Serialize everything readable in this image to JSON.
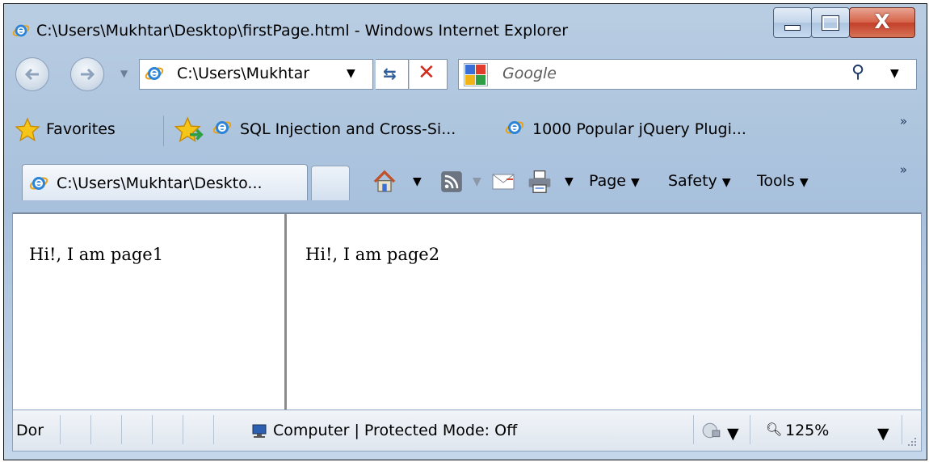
{
  "window": {
    "title": "C:\\Users\\Mukhtar\\Desktop\\firstPage.html - Windows Internet Explorer"
  },
  "address_bar": {
    "url": "C:\\Users\\Mukhtar",
    "dropdown": "▼",
    "search_placeholder": "Google"
  },
  "favorites_bar": {
    "label": "Favorites",
    "links": [
      "SQL Injection and Cross-Si...",
      "1000 Popular jQuery Plugi..."
    ],
    "chevron": "»"
  },
  "tabs": [
    {
      "label": "C:\\Users\\Mukhtar\\Deskto..."
    }
  ],
  "command_bar": {
    "page_label": "Page",
    "safety_label": "Safety",
    "tools_label": "Tools",
    "dropdown": "▼",
    "chevron": "»"
  },
  "frames": [
    {
      "text": "Hi!, I am page1"
    },
    {
      "text": "Hi!, I am page2"
    }
  ],
  "status_bar": {
    "status_text": "Dor",
    "zone_text": "Computer | Protected Mode: Off",
    "zoom_label": "125%",
    "dropdown": "▼"
  },
  "colors": {
    "frame_accent": "#a7c0dc",
    "close_button": "#d6644a",
    "stop_icon": "#d02a1c",
    "ie_blue": "#1f6fc8"
  },
  "icons": [
    "ie-logo-icon",
    "back-arrow-icon",
    "forward-arrow-icon",
    "refresh-icon",
    "stop-icon",
    "google-icon",
    "search-icon",
    "favorites-star-icon",
    "add-favorite-icon",
    "home-icon",
    "feeds-icon",
    "read-mail-icon",
    "print-icon",
    "computer-icon",
    "globe-lock-icon",
    "zoom-icon",
    "resize-grip-icon"
  ]
}
